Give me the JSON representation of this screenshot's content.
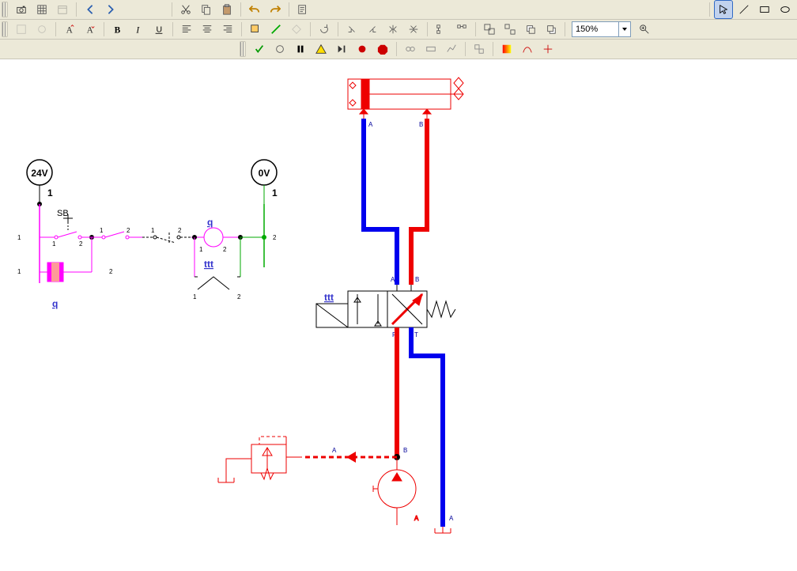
{
  "zoom": {
    "value": "150%"
  },
  "elec": {
    "v24": "24V",
    "v0": "0V",
    "sb": "SB",
    "q1": "q",
    "q2": "q",
    "ttt": "ttt",
    "n1": "1",
    "n2": "2"
  },
  "hyd": {
    "a": "A",
    "b": "B",
    "p": "P",
    "t": "T",
    "valve_ttt": "ttt"
  }
}
